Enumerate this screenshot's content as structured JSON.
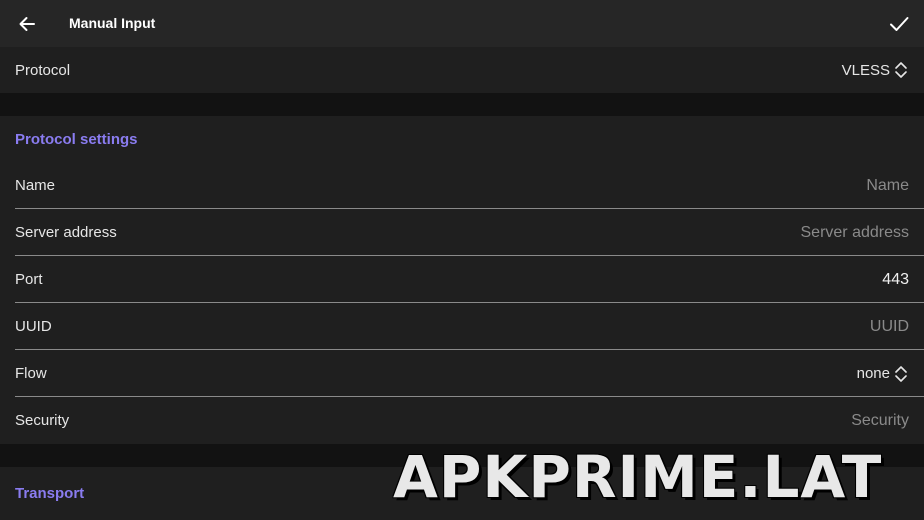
{
  "appbar": {
    "title": "Manual Input",
    "back_icon": "arrow-left-icon",
    "confirm_icon": "check-icon"
  },
  "protocol": {
    "label": "Protocol",
    "value": "VLESS",
    "icon": "unfold-icon"
  },
  "protocol_settings": {
    "header": "Protocol settings",
    "name": {
      "label": "Name",
      "placeholder": "Name"
    },
    "server_address": {
      "label": "Server address",
      "placeholder": "Server address"
    },
    "port": {
      "label": "Port",
      "value": "443"
    },
    "uuid": {
      "label": "UUID",
      "placeholder": "UUID"
    },
    "flow": {
      "label": "Flow",
      "value": "none",
      "icon": "unfold-icon"
    },
    "security": {
      "label": "Security",
      "placeholder": "Security"
    }
  },
  "transport": {
    "header": "Transport"
  },
  "watermark": "APKPRIME.LAT",
  "colors": {
    "accent": "#8a7cf0",
    "background": "#121212",
    "surface": "#1f1f1f",
    "appbar": "#262626"
  }
}
